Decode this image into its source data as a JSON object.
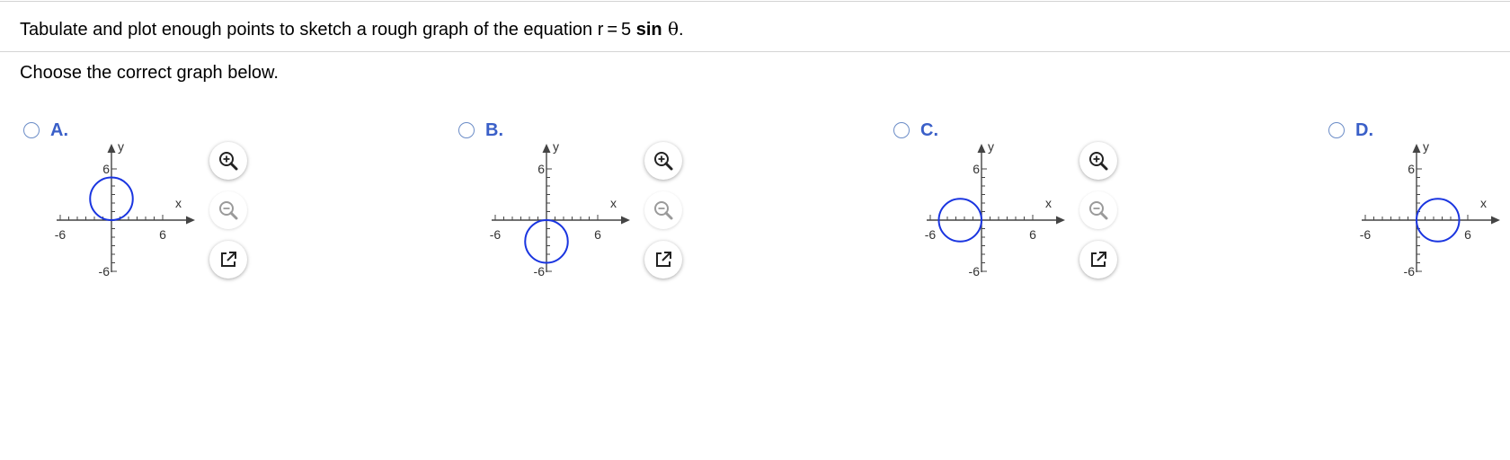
{
  "question": {
    "prefix": "Tabulate and plot enough points to sketch a rough graph of the equation r = 5 ",
    "bold": "sin",
    "theta": " θ",
    "suffix": "."
  },
  "instruction": "Choose the correct graph below.",
  "colors": {
    "accent": "#3a5fc8",
    "curve": "#1a35e0",
    "axis": "#444444"
  },
  "options": [
    {
      "letter": "A.",
      "selected": false,
      "circle_center": [
        0,
        2.5
      ],
      "circle_radius": 2.5,
      "axis_labels": {
        "x": "x",
        "y": "y"
      },
      "ticks": {
        "xmin": "-6",
        "xmax": "6",
        "ymax": "6",
        "ymin": "-6"
      }
    },
    {
      "letter": "B.",
      "selected": false,
      "circle_center": [
        0,
        -2.5
      ],
      "circle_radius": 2.5,
      "axis_labels": {
        "x": "x",
        "y": "y"
      },
      "ticks": {
        "xmin": "-6",
        "xmax": "6",
        "ymax": "6",
        "ymin": "-6"
      }
    },
    {
      "letter": "C.",
      "selected": false,
      "circle_center": [
        -2.5,
        0
      ],
      "circle_radius": 2.5,
      "axis_labels": {
        "x": "x",
        "y": "y"
      },
      "ticks": {
        "xmin": "-6",
        "xmax": "6",
        "ymax": "6",
        "ymin": "-6"
      }
    },
    {
      "letter": "D.",
      "selected": false,
      "circle_center": [
        2.5,
        0
      ],
      "circle_radius": 2.5,
      "axis_labels": {
        "x": "x",
        "y": "y"
      },
      "ticks": {
        "xmin": "-6",
        "xmax": "6",
        "ymax": "6",
        "ymin": "-6"
      }
    }
  ],
  "tools": [
    "zoom-in-icon",
    "zoom-out-icon",
    "open-external-icon"
  ]
}
